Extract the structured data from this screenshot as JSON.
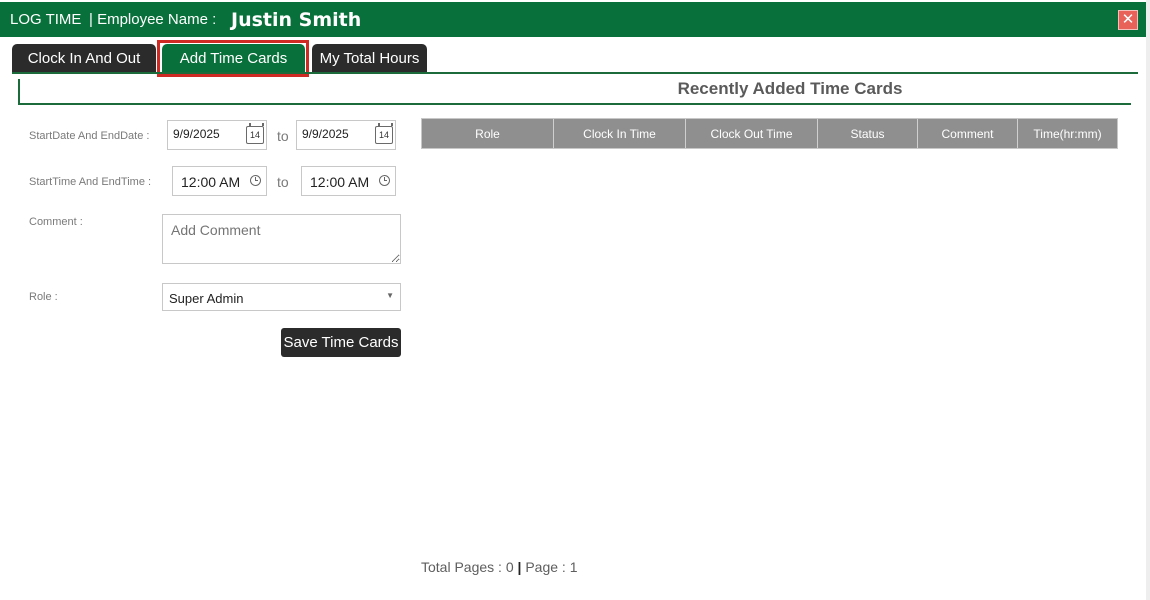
{
  "titlebar": {
    "app_title": "LOG TIME",
    "employee_label": "| Employee Name :",
    "employee_name": "Justin Smith",
    "close_symbol": "✕"
  },
  "tabs": [
    {
      "label": "Clock In And Out",
      "active": false
    },
    {
      "label": "Add Time Cards",
      "active": true
    },
    {
      "label": "My Total Hours",
      "active": false
    }
  ],
  "form": {
    "date_label": "StartDate And EndDate :",
    "start_date": "9/9/2025",
    "end_date": "9/9/2025",
    "to_label": "to",
    "calendar_day": "14",
    "time_label": "StartTime And EndTime :",
    "start_time": "12:00 AM",
    "end_time": "12:00 AM",
    "comment_label": "Comment :",
    "comment_placeholder": "Add Comment",
    "role_label": "Role :",
    "role_selected": "Super Admin",
    "save_label": "Save Time Cards"
  },
  "recent": {
    "title": "Recently Added Time Cards",
    "columns": [
      "Role",
      "Clock In Time",
      "Clock Out Time",
      "Status",
      "Comment",
      "Time(hr:mm)"
    ],
    "rows": []
  },
  "pager": {
    "total_pages_text": "Total Pages : 0",
    "separator": "|",
    "page_text": "Page : 1"
  },
  "colors": {
    "accent_green": "#08703a",
    "dark_tab": "#2b2b2b",
    "highlight_red": "#cf2b24",
    "grid_header": "#8f8f8f"
  }
}
